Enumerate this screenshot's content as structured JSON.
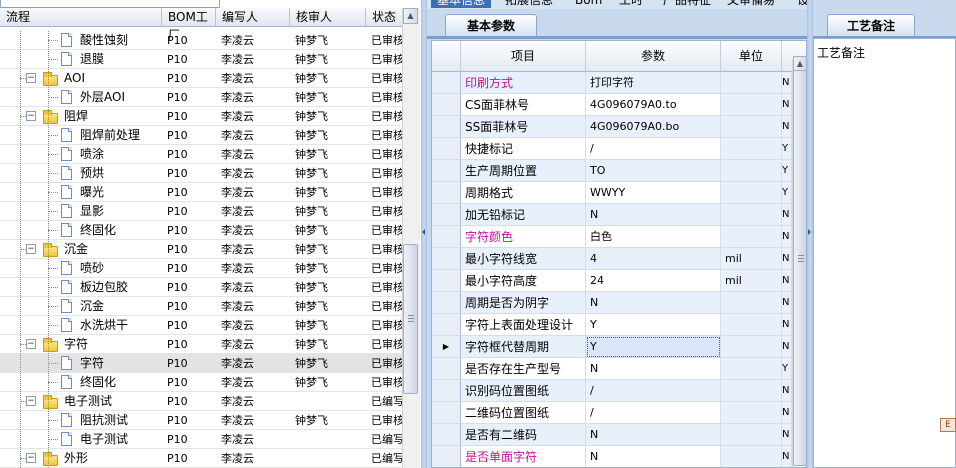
{
  "tree": {
    "columns": [
      "流程",
      "BOM工厂",
      "编写人",
      "核审人",
      "状态"
    ],
    "rows": [
      {
        "name": "酸性蚀刻",
        "level": 2,
        "kind": "doc",
        "factory": "P10",
        "author": "李凌云",
        "reviewer": "钟梦飞",
        "status": "已审核"
      },
      {
        "name": "退膜",
        "level": 2,
        "kind": "doc",
        "factory": "P10",
        "author": "李凌云",
        "reviewer": "钟梦飞",
        "status": "已审核"
      },
      {
        "name": "AOI",
        "level": 1,
        "kind": "folder",
        "factory": "P10",
        "author": "李凌云",
        "reviewer": "钟梦飞",
        "status": "已审核"
      },
      {
        "name": "外层AOI",
        "level": 2,
        "kind": "doc",
        "factory": "P10",
        "author": "李凌云",
        "reviewer": "钟梦飞",
        "status": "已审核"
      },
      {
        "name": "阻焊",
        "level": 1,
        "kind": "folder",
        "factory": "P10",
        "author": "李凌云",
        "reviewer": "钟梦飞",
        "status": "已审核"
      },
      {
        "name": "阻焊前处理",
        "level": 2,
        "kind": "doc",
        "factory": "P10",
        "author": "李凌云",
        "reviewer": "钟梦飞",
        "status": "已审核"
      },
      {
        "name": "喷涂",
        "level": 2,
        "kind": "doc",
        "factory": "P10",
        "author": "李凌云",
        "reviewer": "钟梦飞",
        "status": "已审核"
      },
      {
        "name": "预烘",
        "level": 2,
        "kind": "doc",
        "factory": "P10",
        "author": "李凌云",
        "reviewer": "钟梦飞",
        "status": "已审核"
      },
      {
        "name": "曝光",
        "level": 2,
        "kind": "doc",
        "factory": "P10",
        "author": "李凌云",
        "reviewer": "钟梦飞",
        "status": "已审核"
      },
      {
        "name": "显影",
        "level": 2,
        "kind": "doc",
        "factory": "P10",
        "author": "李凌云",
        "reviewer": "钟梦飞",
        "status": "已审核"
      },
      {
        "name": "终固化",
        "level": 2,
        "kind": "doc",
        "factory": "P10",
        "author": "李凌云",
        "reviewer": "钟梦飞",
        "status": "已审核"
      },
      {
        "name": "沉金",
        "level": 1,
        "kind": "folder",
        "factory": "P10",
        "author": "李凌云",
        "reviewer": "钟梦飞",
        "status": "已审核"
      },
      {
        "name": "喷砂",
        "level": 2,
        "kind": "doc",
        "factory": "P10",
        "author": "李凌云",
        "reviewer": "钟梦飞",
        "status": "已审核"
      },
      {
        "name": "板边包胶",
        "level": 2,
        "kind": "doc",
        "factory": "P10",
        "author": "李凌云",
        "reviewer": "钟梦飞",
        "status": "已审核"
      },
      {
        "name": "沉金",
        "level": 2,
        "kind": "doc",
        "factory": "P10",
        "author": "李凌云",
        "reviewer": "钟梦飞",
        "status": "已审核"
      },
      {
        "name": "水洗烘干",
        "level": 2,
        "kind": "doc",
        "factory": "P10",
        "author": "李凌云",
        "reviewer": "钟梦飞",
        "status": "已审核"
      },
      {
        "name": "字符",
        "level": 1,
        "kind": "folder",
        "factory": "P10",
        "author": "李凌云",
        "reviewer": "钟梦飞",
        "status": "已审核"
      },
      {
        "name": "字符",
        "level": 2,
        "kind": "doc",
        "factory": "P10",
        "author": "李凌云",
        "reviewer": "钟梦飞",
        "status": "已审核",
        "selected": true
      },
      {
        "name": "终固化",
        "level": 2,
        "kind": "doc",
        "factory": "P10",
        "author": "李凌云",
        "reviewer": "钟梦飞",
        "status": "已审核"
      },
      {
        "name": "电子测试",
        "level": 1,
        "kind": "folder",
        "factory": "P10",
        "author": "李凌云",
        "reviewer": "",
        "status": "已编写"
      },
      {
        "name": "阻抗测试",
        "level": 2,
        "kind": "doc",
        "factory": "P10",
        "author": "李凌云",
        "reviewer": "钟梦飞",
        "status": "已审核"
      },
      {
        "name": "电子测试",
        "level": 2,
        "kind": "doc",
        "factory": "P10",
        "author": "李凌云",
        "reviewer": "",
        "status": "已编写"
      },
      {
        "name": "外形",
        "level": 1,
        "kind": "folder",
        "factory": "P10",
        "author": "李凌云",
        "reviewer": "",
        "status": "已编写"
      }
    ]
  },
  "top_tabs": [
    "基本信息",
    "拓展信息",
    "Bom",
    "工时",
    "产品特征",
    "文审備易",
    "设备備易"
  ],
  "mid_tab": "基本参数",
  "param_grid": {
    "columns": [
      "项目",
      "参数",
      "单位"
    ],
    "rows": [
      {
        "item": "印刷方式",
        "value": "打印字符",
        "unit": "",
        "flag": "N",
        "highlight": true
      },
      {
        "item": "CS面菲林号",
        "value": "4G096079A0.to",
        "unit": "",
        "flag": "N"
      },
      {
        "item": "SS面菲林号",
        "value": "4G096079A0.bo",
        "unit": "",
        "flag": "N"
      },
      {
        "item": "快捷标记",
        "value": "/",
        "unit": "",
        "flag": "Y"
      },
      {
        "item": "生产周期位置",
        "value": "TO",
        "unit": "",
        "flag": "Y"
      },
      {
        "item": "周期格式",
        "value": "WWYY",
        "unit": "",
        "flag": "Y"
      },
      {
        "item": "加无铅标记",
        "value": "N",
        "unit": "",
        "flag": "N"
      },
      {
        "item": "字符颜色",
        "value": "白色",
        "unit": "",
        "flag": "N",
        "highlight": true
      },
      {
        "item": "最小字符线宽",
        "value": "4",
        "unit": "mil",
        "flag": "N"
      },
      {
        "item": "最小字符高度",
        "value": "24",
        "unit": "mil",
        "flag": "N"
      },
      {
        "item": "周期是否为阴字",
        "value": "N",
        "unit": "",
        "flag": "N"
      },
      {
        "item": "字符上表面处理设计",
        "value": "Y",
        "unit": "",
        "flag": "N"
      },
      {
        "item": "字符框代替周期",
        "value": "Y",
        "unit": "",
        "flag": "N",
        "current": true
      },
      {
        "item": "是否存在生产型号",
        "value": "N",
        "unit": "",
        "flag": "Y"
      },
      {
        "item": "识别码位置图纸",
        "value": "/",
        "unit": "",
        "flag": "N"
      },
      {
        "item": "二维码位置图纸",
        "value": "/",
        "unit": "",
        "flag": "N"
      },
      {
        "item": "是否有二维码",
        "value": "N",
        "unit": "",
        "flag": "N"
      },
      {
        "item": "是否单面字符",
        "value": "N",
        "unit": "",
        "flag": "N",
        "highlight": true
      }
    ]
  },
  "right_panel": {
    "tab": "工艺备注",
    "label": "工艺备注"
  },
  "colors": {
    "highlight_item": "#c0139c",
    "panel_bg": "#c8d9ee",
    "accent": "#3b6fb6"
  }
}
